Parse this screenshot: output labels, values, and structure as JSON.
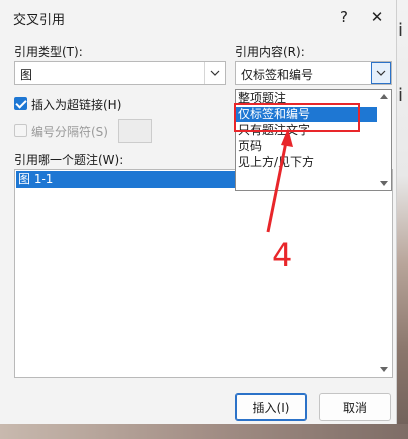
{
  "dialog": {
    "title": "交叉引用",
    "help_glyph": "?",
    "close_glyph": "✕"
  },
  "ref_type": {
    "label": "引用类型(T):",
    "value": "图"
  },
  "ref_content": {
    "label": "引用内容(R):",
    "value": "仅标签和编号",
    "options": [
      "整项题注",
      "仅标签和编号",
      "只有题注文字",
      "页码",
      "见上方/见下方"
    ],
    "selected_index": 1
  },
  "insert_hyperlink": {
    "label": "插入为超链接(H)",
    "checked": true
  },
  "number_separator": {
    "label": "编号分隔符(S)",
    "checked": false,
    "disabled": true
  },
  "caption_list": {
    "label": "引用哪一个题注(W):",
    "items": [
      "图 1-1"
    ]
  },
  "buttons": {
    "insert": "插入(I)",
    "cancel": "取消"
  },
  "annotation": {
    "number": "4",
    "color": "#e8262a"
  },
  "background_glyphs": [
    "i",
    "i"
  ],
  "colors": {
    "accent": "#1e77d3",
    "annotation_red": "#e8262a"
  }
}
